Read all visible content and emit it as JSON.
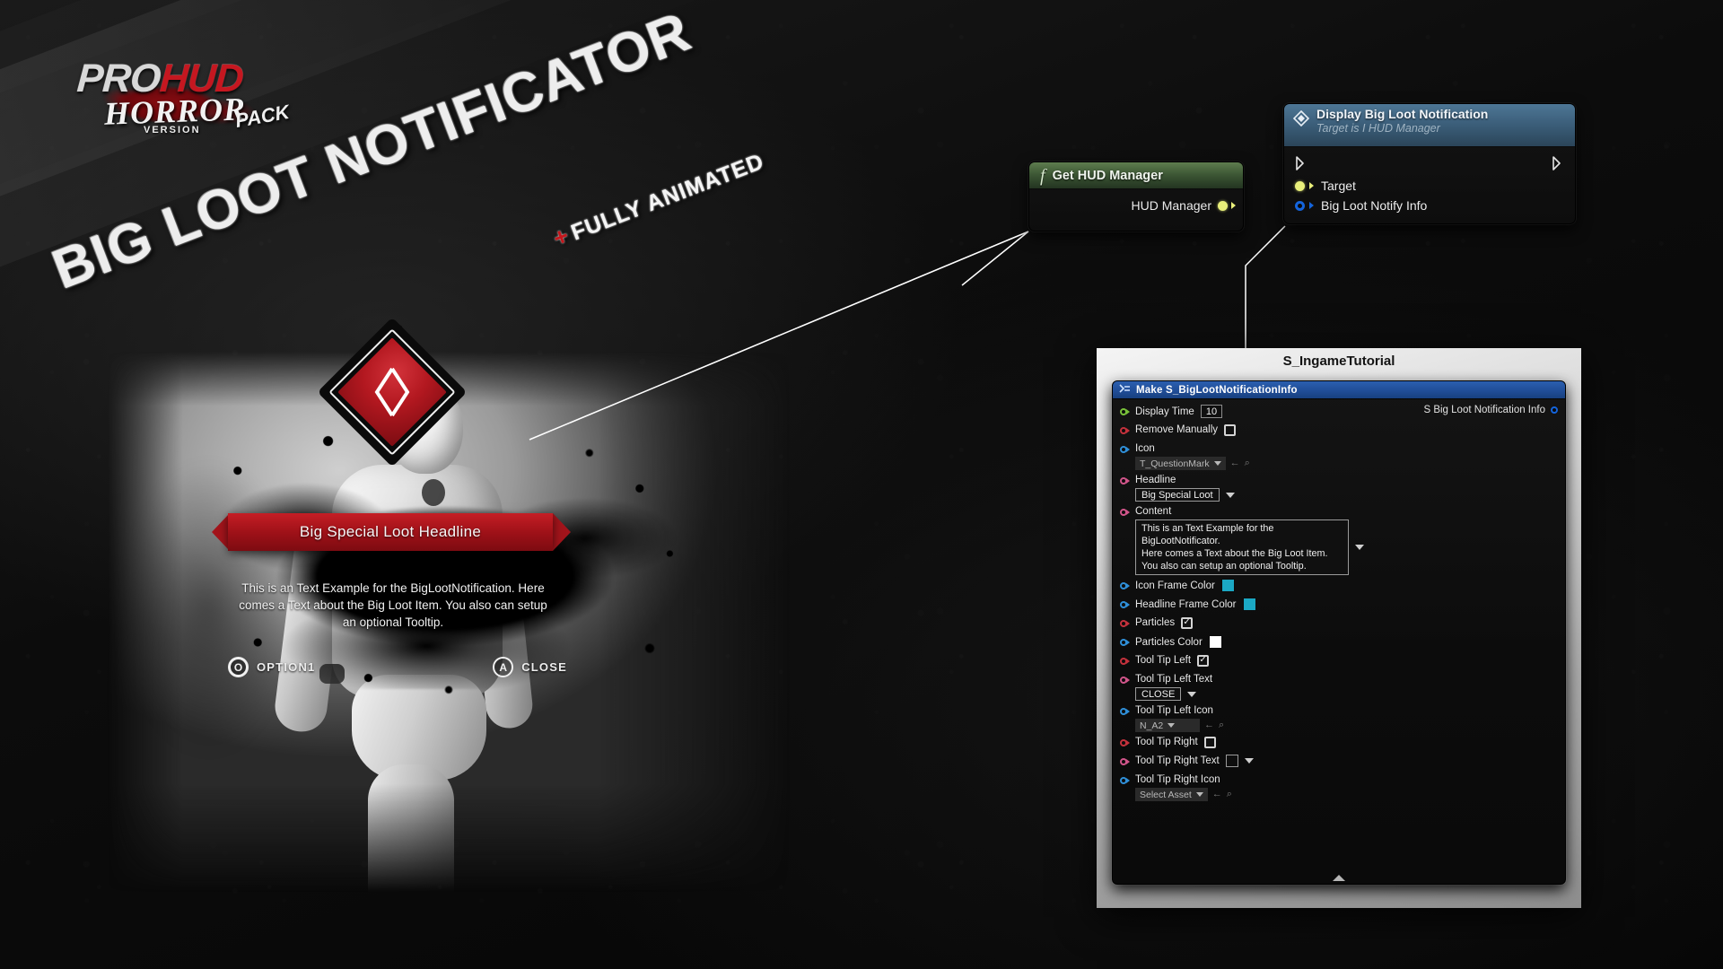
{
  "brand": {
    "pro": "PRO",
    "hud": "HUD",
    "horror": "HORROR",
    "version": "VERSION",
    "pack": "PACK"
  },
  "title": {
    "main": "BIG LOOT NOTIFICATOR",
    "plus": "+",
    "sub": "FULLY ANIMATED"
  },
  "hud_preview": {
    "headline": "Big Special Loot Headline",
    "body": "This is an Text Example for the BigLootNotification. Here comes a Text about the Big Loot Item. You also can setup an optional Tooltip.",
    "tooltip_left_key": "O",
    "tooltip_left_label": "OPTION1",
    "tooltip_right_key": "A",
    "tooltip_right_label": "CLOSE",
    "accent_color": "#b31820"
  },
  "nodes": {
    "get_hud_manager": {
      "title": "Get HUD Manager",
      "fn_glyph": "f",
      "output_pin": "HUD Manager"
    },
    "display_notification": {
      "title": "Display Big Loot Notification",
      "subtitle": "Target is I HUD Manager",
      "pins": [
        {
          "label": "Target",
          "type": "object",
          "color": "#e9ef7a"
        },
        {
          "label": "Big Loot Notify Info",
          "type": "struct",
          "color": "#1464dc"
        }
      ]
    }
  },
  "graph_panel": {
    "panel_title": "S_IngameTutorial",
    "node_title": "Make S_BigLootNotificationInfo",
    "output_label": "S Big Loot Notification Info",
    "collapse_hint": "collapse",
    "rows": [
      {
        "name": "display-time",
        "label": "Display Time",
        "pin": "green",
        "widget": "number",
        "value": "10",
        "layout": "inline"
      },
      {
        "name": "remove-manually",
        "label": "Remove Manually",
        "pin": "red",
        "widget": "checkbox",
        "value": "",
        "layout": "inline"
      },
      {
        "name": "icon",
        "label": "Icon",
        "pin": "blue",
        "widget": "asset",
        "value": "T_QuestionMark",
        "layout": "stacked"
      },
      {
        "name": "headline",
        "label": "Headline",
        "pin": "pink",
        "widget": "text",
        "value": "Big Special Loot",
        "layout": "stacked"
      },
      {
        "name": "content",
        "label": "Content",
        "pin": "pink",
        "widget": "textarea",
        "value": "This is an Text Example for the BigLootNotificator.\nHere comes a Text about the Big Loot Item.\nYou also can setup an optional Tooltip.",
        "layout": "stacked"
      },
      {
        "name": "icon-frame-color",
        "label": "Icon Frame Color",
        "pin": "blue",
        "widget": "swatch",
        "value": "#1ba8c4",
        "layout": "inline"
      },
      {
        "name": "headline-frame-color",
        "label": "Headline Frame Color",
        "pin": "blue",
        "widget": "swatch",
        "value": "#1ba8c4",
        "layout": "inline"
      },
      {
        "name": "particles",
        "label": "Particles",
        "pin": "red",
        "widget": "checkbox",
        "value": "checked",
        "layout": "inline"
      },
      {
        "name": "particles-color",
        "label": "Particles Color",
        "pin": "blue",
        "widget": "swatch",
        "value": "#ffffff",
        "layout": "inline"
      },
      {
        "name": "tool-tip-left",
        "label": "Tool Tip Left",
        "pin": "red",
        "widget": "checkbox",
        "value": "checked",
        "layout": "inline"
      },
      {
        "name": "tool-tip-left-text",
        "label": "Tool Tip Left Text",
        "pin": "pink",
        "widget": "text",
        "value": "CLOSE",
        "layout": "stacked"
      },
      {
        "name": "tool-tip-left-icon",
        "label": "Tool Tip Left Icon",
        "pin": "blue",
        "widget": "asset",
        "value": "N_A2",
        "layout": "stacked"
      },
      {
        "name": "tool-tip-right",
        "label": "Tool Tip Right",
        "pin": "red",
        "widget": "checkbox",
        "value": "",
        "layout": "inline"
      },
      {
        "name": "tool-tip-right-text",
        "label": "Tool Tip Right Text",
        "pin": "pink",
        "widget": "emptytext",
        "value": "",
        "layout": "inline"
      },
      {
        "name": "tool-tip-right-icon",
        "label": "Tool Tip Right Icon",
        "pin": "blue",
        "widget": "asset",
        "value": "Select Asset",
        "layout": "stacked"
      }
    ]
  }
}
